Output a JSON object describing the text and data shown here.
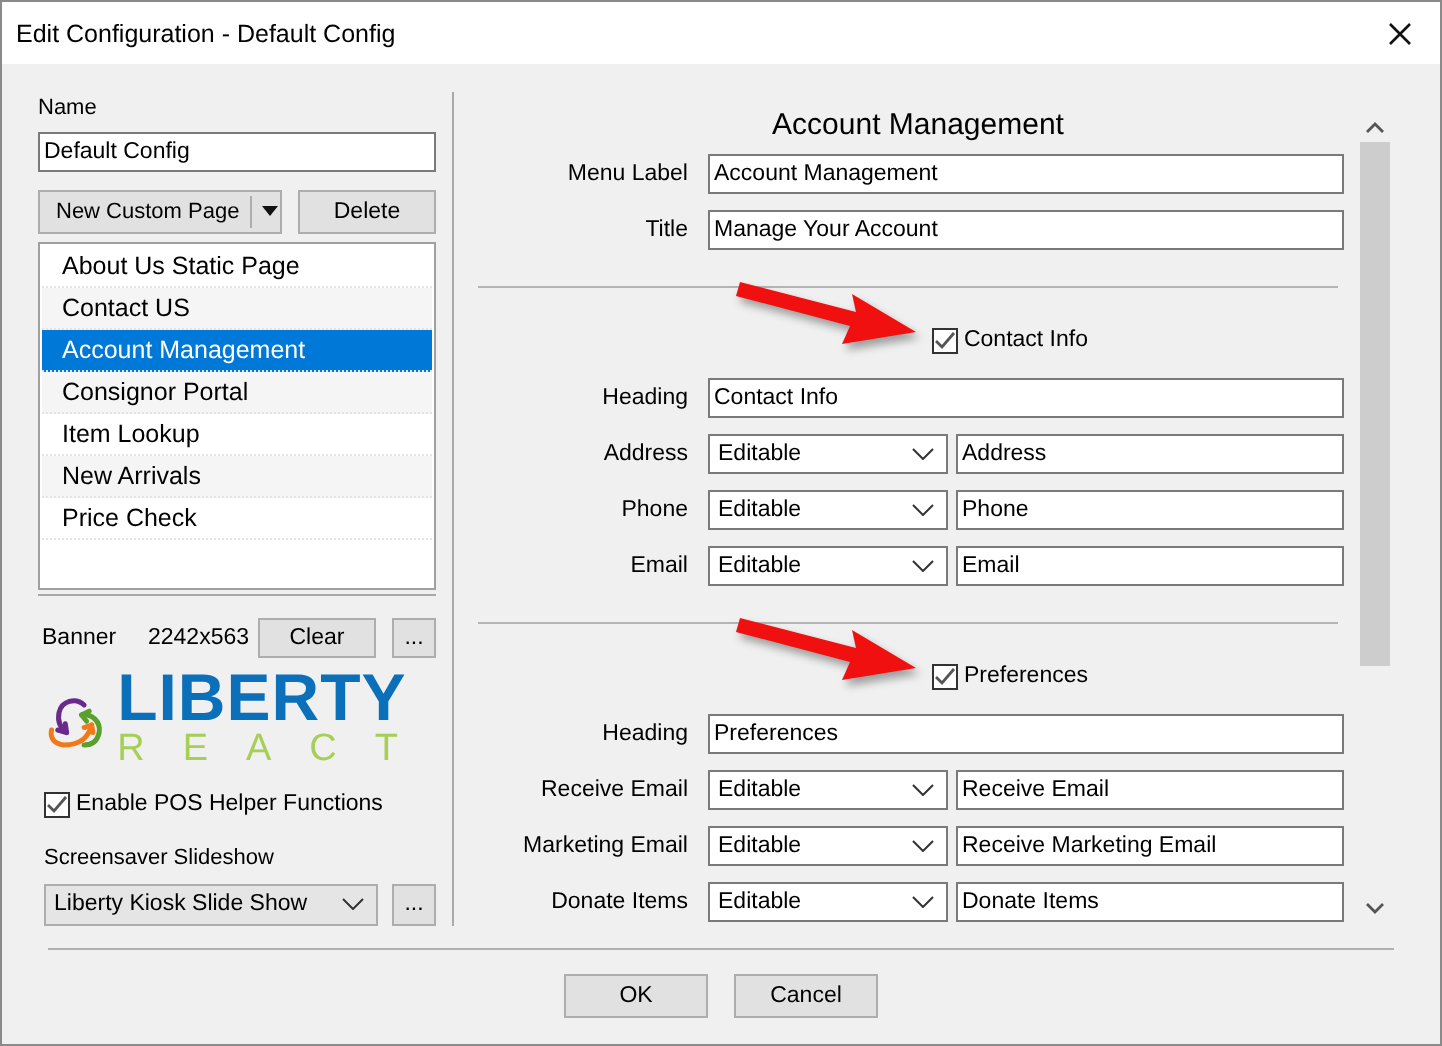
{
  "window": {
    "title": "Edit Configuration - Default Config"
  },
  "left": {
    "name_label": "Name",
    "name_value": "Default Config",
    "new_button": "New Custom Page",
    "delete_button": "Delete",
    "pages": [
      {
        "label": "About Us Static Page",
        "selected": false
      },
      {
        "label": "Contact US",
        "selected": false
      },
      {
        "label": "Account Management",
        "selected": true
      },
      {
        "label": "Consignor Portal",
        "selected": false
      },
      {
        "label": "Item Lookup",
        "selected": false
      },
      {
        "label": "New Arrivals",
        "selected": false
      },
      {
        "label": "Price Check",
        "selected": false
      }
    ],
    "banner": {
      "label": "Banner",
      "size": "2242x563",
      "clear_button": "Clear",
      "browse_button": "..."
    },
    "logo": {
      "top": "LIBERTY",
      "bottom": "REACT"
    },
    "pos_helper": {
      "label": "Enable POS Helper Functions",
      "checked": true
    },
    "slideshow": {
      "label": "Screensaver Slideshow",
      "value": "Liberty Kiosk Slide Show",
      "browse_button": "..."
    }
  },
  "editor": {
    "title": "Account Management",
    "fields": [
      {
        "label": "Menu Label",
        "value": "Account Management"
      },
      {
        "label": "Title",
        "value": "Manage Your Account"
      }
    ],
    "sections": [
      {
        "label": "Contact Info",
        "checked": true,
        "arrow": true,
        "heading_label": "Heading",
        "heading": "Contact Info",
        "rows": [
          {
            "label": "Address",
            "mode": "Editable",
            "value": "Address"
          },
          {
            "label": "Phone",
            "mode": "Editable",
            "value": "Phone"
          },
          {
            "label": "Email",
            "mode": "Editable",
            "value": "Email"
          }
        ]
      },
      {
        "label": "Preferences",
        "checked": true,
        "arrow": true,
        "heading_label": "Heading",
        "heading": "Preferences",
        "rows": [
          {
            "label": "Receive Email",
            "mode": "Editable",
            "value": "Receive Email"
          },
          {
            "label": "Marketing Email",
            "mode": "Editable",
            "value": "Receive Marketing Email"
          },
          {
            "label": "Donate Items",
            "mode": "Editable",
            "value": "Donate Items"
          }
        ]
      }
    ]
  },
  "buttons": [
    "OK",
    "Cancel"
  ]
}
